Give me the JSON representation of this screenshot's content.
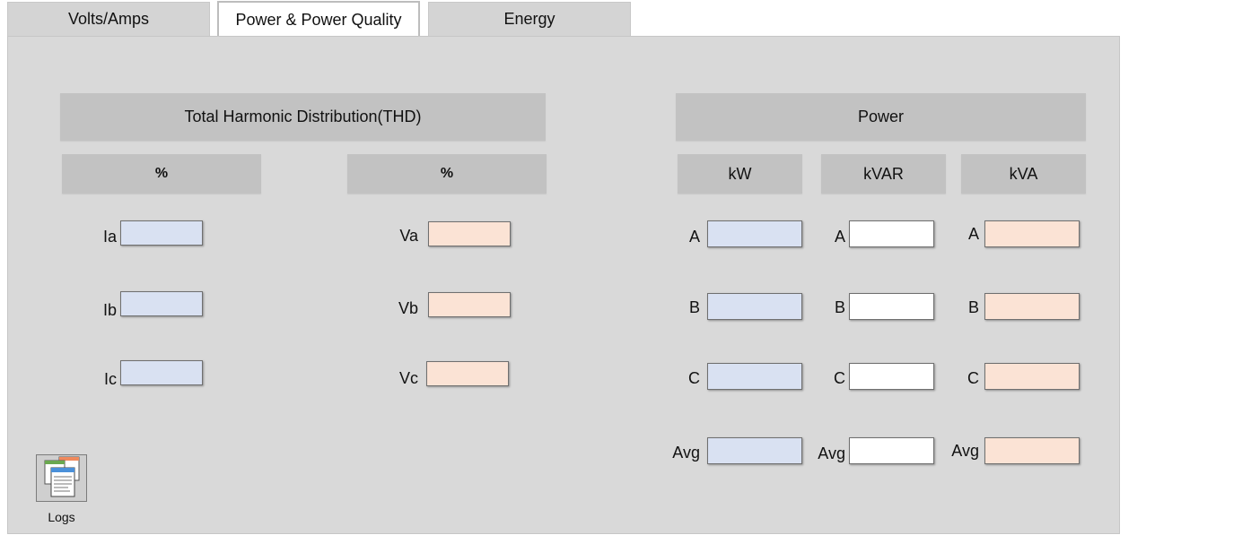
{
  "tabs": [
    {
      "label": "Volts/Amps"
    },
    {
      "label": "Power & Power Quality"
    },
    {
      "label": "Energy"
    }
  ],
  "thd": {
    "title": "Total Harmonic Distribution(THD)",
    "current_header": "%",
    "voltage_header": "%",
    "current_labels": [
      "Ia",
      "Ib",
      "Ic"
    ],
    "voltage_labels": [
      "Va",
      "Vb",
      "Vc"
    ]
  },
  "power": {
    "title": "Power",
    "columns": [
      "kW",
      "kVAR",
      "kVA"
    ],
    "row_labels": [
      "A",
      "B",
      "C",
      "Avg"
    ]
  },
  "logs": {
    "label": "Logs",
    "icon": "logs-icon"
  },
  "colors": {
    "current_field": "#d9e1f2",
    "voltage_field": "#fbe3d5",
    "kvar_field": "#ffffff",
    "panel_bg": "#d9d9d9",
    "header_bg": "#c2c2c2"
  }
}
